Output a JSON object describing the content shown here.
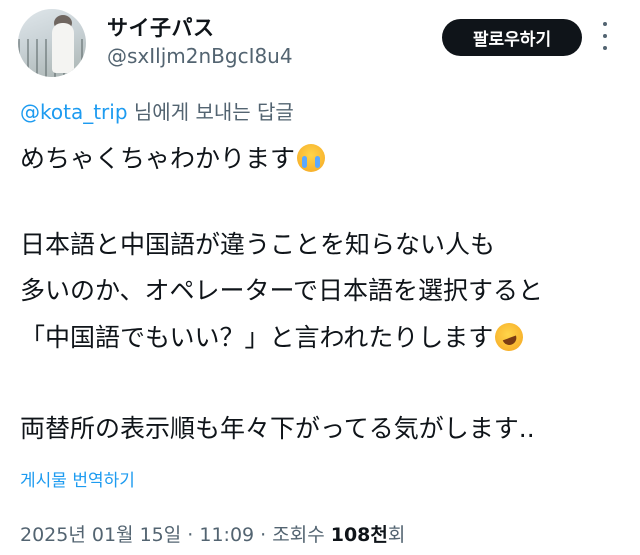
{
  "author": {
    "display_name": "サイ子パス",
    "handle": "@sxIljm2nBgcI8u4"
  },
  "follow_button_label": "팔로우하기",
  "more_icon": "more-vertical-icon",
  "reply": {
    "mention": "@kota_trip",
    "suffix": " 님에게 보내는 답글"
  },
  "tweet": {
    "line1": "めちゃくちゃわかります",
    "line1_emoji": "loudly-crying-face",
    "line2": "日本語と中国語が違うことを知らない人も",
    "line3": "多いのか、オペレーターで日本語を選択すると",
    "line4": "「中国語でもいい？」と言われたりします",
    "line4_emoji": "rolling-on-floor-laughing-face",
    "line5": "両替所の表示順も年々下がってる気がします.."
  },
  "translate_label": "게시물 번역하기",
  "meta": {
    "date": "2025년 01월 15일",
    "sep1": " · ",
    "time": "11:09",
    "sep2": " · ",
    "views_prefix": "조회수 ",
    "views_count": "108천",
    "views_suffix": "회"
  },
  "colors": {
    "link": "#1d9bf0",
    "secondary_text": "#536471",
    "primary_text": "#0f1419"
  }
}
